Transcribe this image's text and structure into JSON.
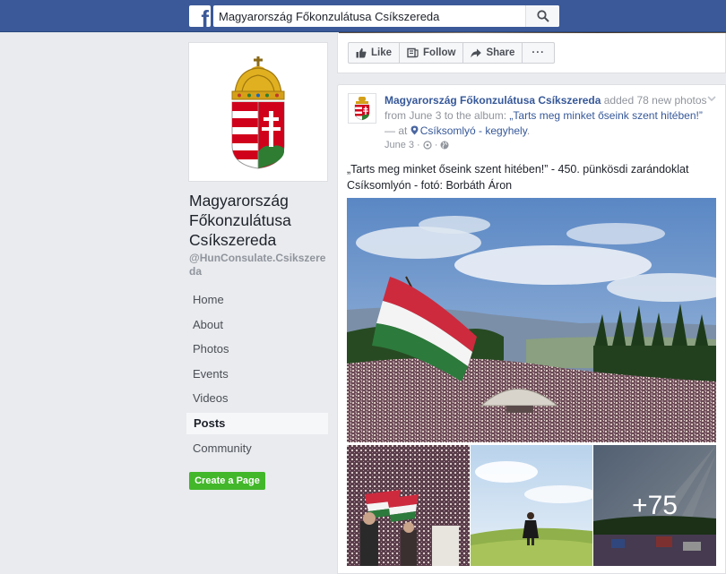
{
  "topbar": {
    "logo_letter": "f",
    "search_value": "Magyarország Főkonzulátusa Csíkszereda"
  },
  "page": {
    "name": "Magyarország Főkonzulátusa Csíkszereda",
    "handle": "@HunConsulate.Csikszereda"
  },
  "nav": {
    "items": [
      {
        "label": "Home"
      },
      {
        "label": "About"
      },
      {
        "label": "Photos"
      },
      {
        "label": "Events"
      },
      {
        "label": "Videos"
      },
      {
        "label": "Posts"
      },
      {
        "label": "Community"
      }
    ],
    "create_page_label": "Create a Page"
  },
  "actions": {
    "like_label": "Like",
    "follow_label": "Follow",
    "share_label": "Share",
    "more_label": "···"
  },
  "post": {
    "author": "Magyarország Főkonzulátusa Csíkszereda",
    "added_text": " added 78 new photos from June 3 to the album: ",
    "album": "„Tarts meg minket őseink szent hitében!”",
    "at_text": " — at ",
    "location": "Csíksomlyó - kegyhely",
    "after_location": ".",
    "date": "June 3",
    "text": "„Tarts meg minket őseink szent hitében!” - 450. pünkösdi zarándoklat Csíksomlyón - fotó: Borbáth Áron",
    "more_photos": "+75"
  },
  "colors": {
    "topbar": "#3b5998",
    "link": "#365899",
    "create_button": "#42b72a"
  }
}
